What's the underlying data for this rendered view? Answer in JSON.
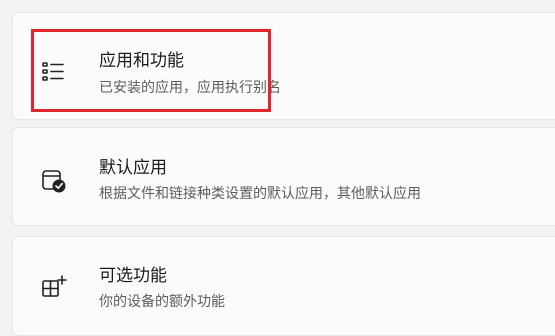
{
  "settings": {
    "items": [
      {
        "title": "应用和功能",
        "subtitle": "已安装的应用，应用执行别名",
        "icon": "apps-list-icon"
      },
      {
        "title": "默认应用",
        "subtitle": "根据文件和链接种类设置的默认应用，其他默认应用",
        "icon": "default-apps-icon"
      },
      {
        "title": "可选功能",
        "subtitle": "你的设备的额外功能",
        "icon": "optional-features-icon"
      }
    ]
  },
  "colors": {
    "highlight": "#e0262d",
    "page_bg": "#f3f3f3",
    "card_bg": "#fbfbfb"
  }
}
